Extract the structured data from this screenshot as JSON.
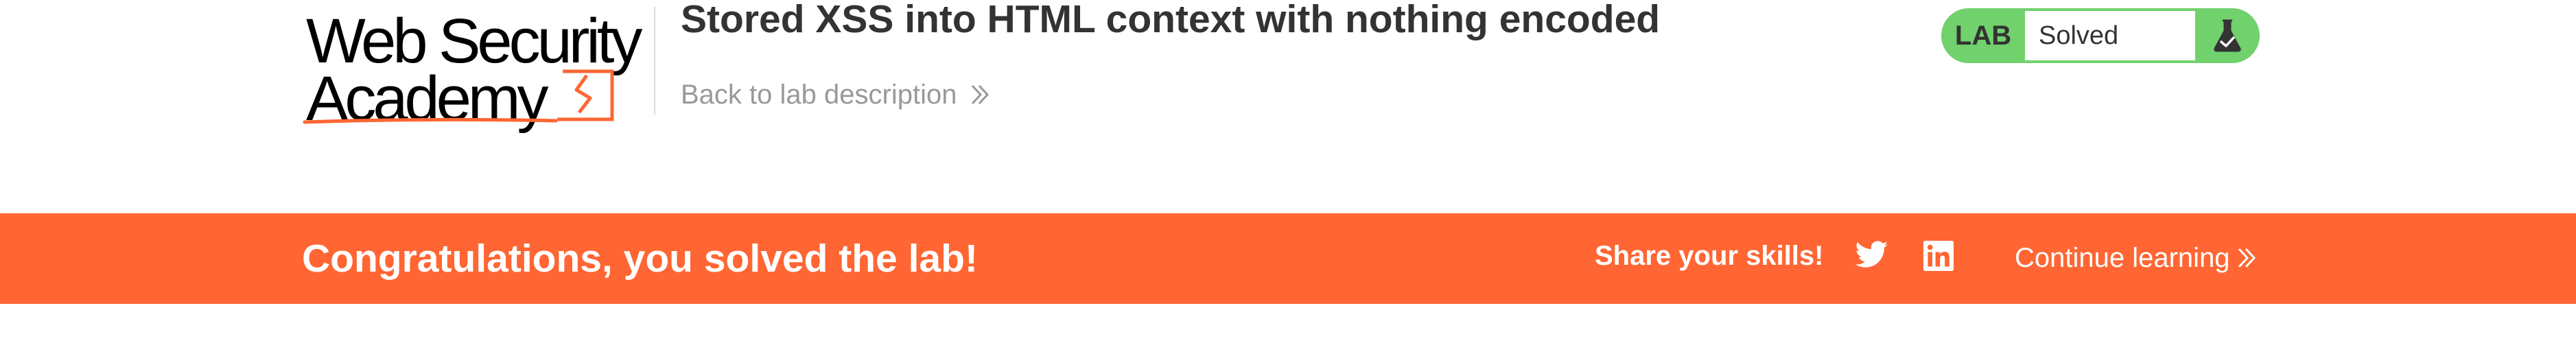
{
  "logo": {
    "line1": "Web Security",
    "line2": "Academy",
    "accent": "#ff6633"
  },
  "lab": {
    "title": "Stored XSS into HTML context with nothing encoded",
    "back_link": "Back to lab description",
    "back_icon": "chevron-double-right-icon"
  },
  "status": {
    "label": "LAB",
    "value": "Solved",
    "icon": "flask-check-icon",
    "color": "#70d16d"
  },
  "banner": {
    "message": "Congratulations, you solved the lab!",
    "share_label": "Share your skills!",
    "share_icons": [
      "twitter-icon",
      "linkedin-icon"
    ],
    "continue_label": "Continue learning",
    "color": "#ff6633"
  }
}
